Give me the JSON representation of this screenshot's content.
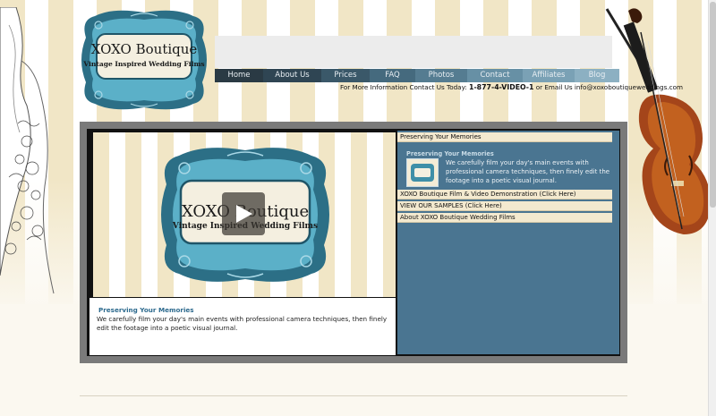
{
  "logo": {
    "name": "XOXO Boutique",
    "tagline": "Vintage Inspired Wedding Films"
  },
  "nav": {
    "items": [
      {
        "label": "Home",
        "color": "#2a3a44",
        "width": 54
      },
      {
        "label": "About Us",
        "color": "#2f4553",
        "width": 65
      },
      {
        "label": "Prices",
        "color": "#3a5869",
        "width": 54
      },
      {
        "label": "FAQ",
        "color": "#456a7e",
        "width": 51
      },
      {
        "label": "Photos",
        "color": "#557c91",
        "width": 58
      },
      {
        "label": "Contact",
        "color": "#6790a5",
        "width": 62
      },
      {
        "label": "Affiliates",
        "color": "#7aa1b5",
        "width": 58
      },
      {
        "label": "Blog",
        "color": "#8cb0c2",
        "width": 50
      }
    ]
  },
  "contact": {
    "prefix": "For More Information Contact Us Today: ",
    "phone": "1-877-4-VIDEO-1",
    "suffix": " or Email Us info@xoxoboutiqueweddings.com"
  },
  "video": {
    "title": "XOXO Boutique",
    "subtitle": "Vintage Inspired Wedding Films",
    "caption_title": "Preserving Your Memories",
    "caption_text": "We carefully film your day's main events with professional camera techniques, then finely edit the footage into a poetic visual journal."
  },
  "sidebar": {
    "top_item": "Preserving Your Memories",
    "feature_title": "Preserving Your Memories",
    "feature_text": "We carefully film your day's main events with professional camera techniques, then finely edit the footage into a poetic visual journal.",
    "items": [
      "XOXO Boutique Film & Video Demonstration (Click Here)",
      "VIEW OUR SAMPLES (Click Here)",
      "About XOXO Boutique Wedding Films"
    ]
  },
  "colors": {
    "teal": "#3f8fa8",
    "teal_dark": "#2c6f86",
    "sidebar_bg": "#4a7591"
  }
}
